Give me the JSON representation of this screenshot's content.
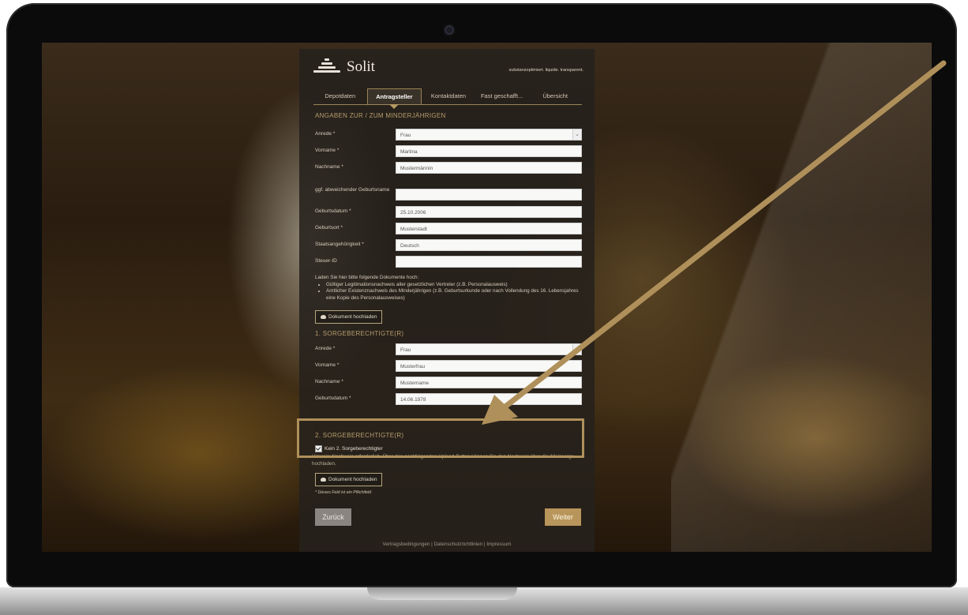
{
  "logo": {
    "name": "Solit",
    "tagline": "substanzoptimiert. liquide. transparent."
  },
  "tabs": [
    {
      "label": "Depotdaten"
    },
    {
      "label": "Antragsteller"
    },
    {
      "label": "Kontaktdaten"
    },
    {
      "label": "Fast geschafft..."
    },
    {
      "label": "Übersicht"
    }
  ],
  "minor_section": {
    "title": "ANGABEN ZUR / ZUM MINDERJÄHRIGEN",
    "fields": [
      {
        "label": "Anrede *",
        "value": "Frau"
      },
      {
        "label": "Vorname *",
        "value": "Martina"
      },
      {
        "label": "Nachname *",
        "value": "Mustermännin"
      },
      {
        "label": "ggf. abweichender Geburtsname",
        "value": ""
      },
      {
        "label": "Geburtsdatum *",
        "value": "25.10.2006"
      },
      {
        "label": "Geburtsort *",
        "value": "Musterstadt"
      },
      {
        "label": "Staatsangehörigkeit *",
        "value": "Deutsch"
      },
      {
        "label": "Steuer-ID",
        "value": ""
      }
    ]
  },
  "documents": {
    "intro": "Laden Sie hier bitte folgende Dokumente hoch:",
    "items": [
      "Gültiger Legitimationsnachweis aller gesetzlichen Vertreter (z.B. Personalausweis)",
      "Amtlicher Existenznachweis des Minderjährigen (z.B. Geburtsurkunde oder nach Vollendung des 16. Lebensjahres eine Kopie des Personalausweises)"
    ],
    "upload_label": "Dokument hochladen"
  },
  "guardian1": {
    "title": "1. SORGEBERECHTIGTE(R)",
    "fields": [
      {
        "label": "Anrede *",
        "value": "Frau"
      },
      {
        "label": "Vorname *",
        "value": "Musterfrau"
      },
      {
        "label": "Nachname *",
        "value": "Mustername"
      },
      {
        "label": "Geburtsdatum *",
        "value": "14.06.1978"
      }
    ]
  },
  "guardian2": {
    "title": "2. SORGEBERECHTIGTE(R)",
    "checkbox_label": "Kein 2. Sorgeberechtigter",
    "hint": "Hinweis: Nachweis erforderlich. Über den nachfolgenden Upload-Button können Sie den Nachweis über die Alleinsorge hochladen.",
    "upload_label": "Dokument hochladen"
  },
  "required_note": "* Dieses Feld ist ein Pflichtfeld",
  "buttons": {
    "back": "Zurück",
    "next": "Weiter"
  },
  "footer": {
    "links": [
      "Vertragsbedingungen",
      "Datenschutzrichtlinien",
      "Impressum"
    ],
    "separator": "|"
  },
  "colors": {
    "accent": "#b8955a",
    "panel_bg": "#26211c",
    "highlight": "#b0905a"
  }
}
